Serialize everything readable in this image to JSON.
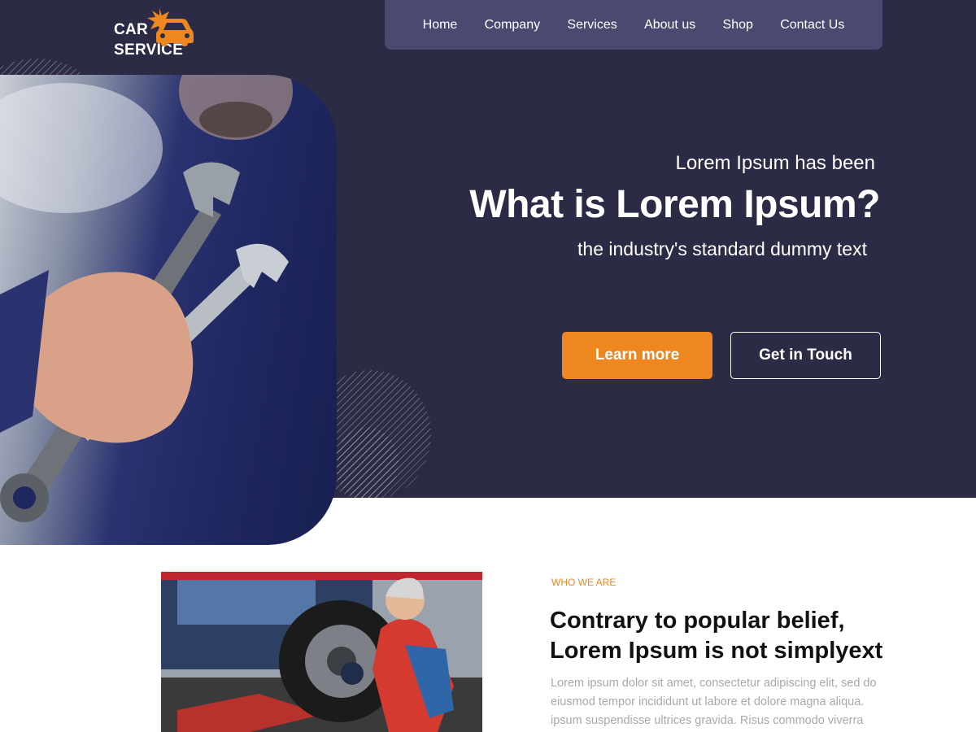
{
  "logo": {
    "line1": "CAR",
    "line2": "SERVICE",
    "icon": "car-starburst-icon"
  },
  "nav": {
    "items": [
      "Home",
      "Company",
      "Services",
      "About us",
      "Shop",
      "Contact Us"
    ]
  },
  "hero": {
    "subtitle": "Lorem Ipsum has been",
    "title": "What is Lorem Ipsum?",
    "description": "the industry's standard dummy text",
    "primary_button": "Learn more",
    "secondary_button": "Get in Touch"
  },
  "about": {
    "label": "WHO WE ARE",
    "title_line1": "Contrary to popular belief,",
    "title_line2": "Lorem Ipsum is not simplyext",
    "text_line1": "Lorem ipsum dolor sit amet, consectetur adipiscing elit, sed do",
    "text_line2": "eiusmod tempor incididunt ut labore et dolore magna aliqua.",
    "text_line3": "ipsum suspendisse ultrices gravida. Risus commodo viverra"
  },
  "colors": {
    "hero_bg": "#2c2b45",
    "nav_bg": "#4a4970",
    "accent": "#ee8720"
  }
}
